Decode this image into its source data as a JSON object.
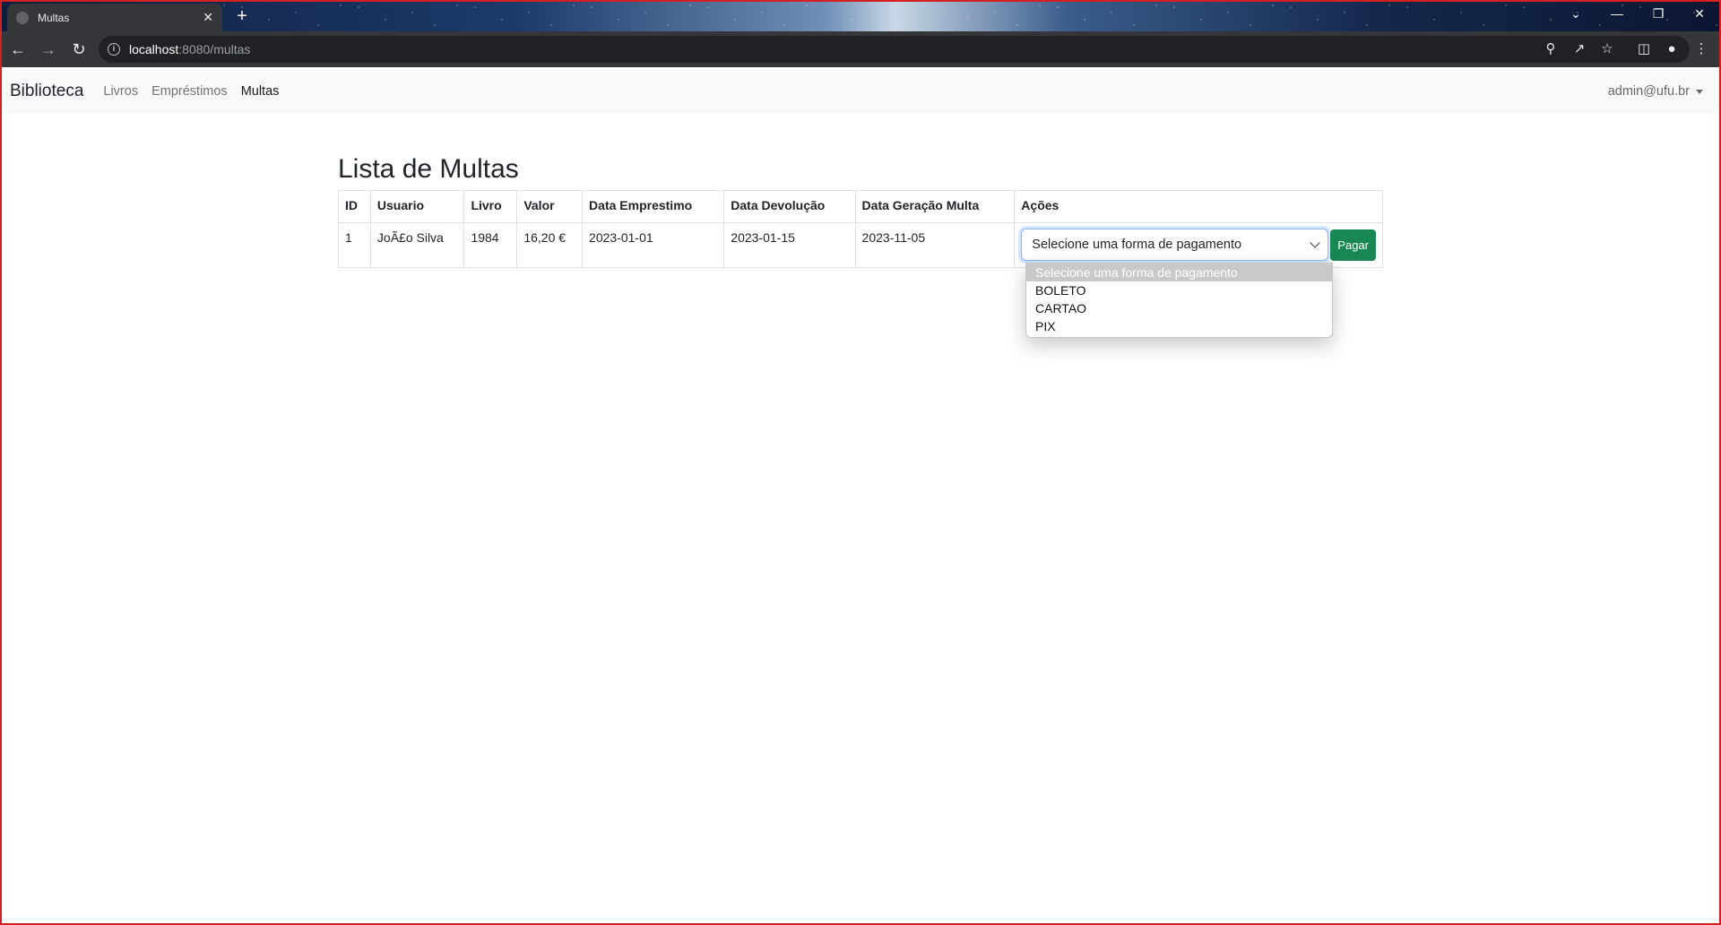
{
  "browser": {
    "tab_title": "Multas",
    "tab_close": "✕",
    "new_tab": "+",
    "url_host": "localhost",
    "url_path": ":8080/multas",
    "window_controls": [
      "⌄",
      "—",
      "❐",
      "✕"
    ]
  },
  "navbar": {
    "brand": "Biblioteca",
    "links": [
      {
        "label": "Livros",
        "active": false
      },
      {
        "label": "Empréstimos",
        "active": false
      },
      {
        "label": "Multas",
        "active": true
      }
    ],
    "user": "admin@ufu.br"
  },
  "page": {
    "title": "Lista de Multas"
  },
  "table": {
    "headers": [
      "ID",
      "Usuario",
      "Livro",
      "Valor",
      "Data Emprestimo",
      "Data Devolução",
      "Data Geração Multa",
      "Ações"
    ],
    "rows": [
      {
        "id": "1",
        "usuario": "JoÃ£o Silva",
        "livro": "1984",
        "valor": "16,20 €",
        "data_emprestimo": "2023-01-01",
        "data_devolucao": "2023-01-15",
        "data_geracao": "2023-11-05",
        "select_value": "Selecione uma forma de pagamento",
        "pay_label": "Pagar"
      }
    ]
  },
  "dropdown": {
    "options": [
      "Selecione uma forma de pagamento",
      "BOLETO",
      "CARTAO",
      "PIX"
    ],
    "selected_index": 0
  },
  "colors": {
    "pay_button": "#198754",
    "focus_border": "#86b7fe",
    "browser_chrome": "#35363a"
  }
}
